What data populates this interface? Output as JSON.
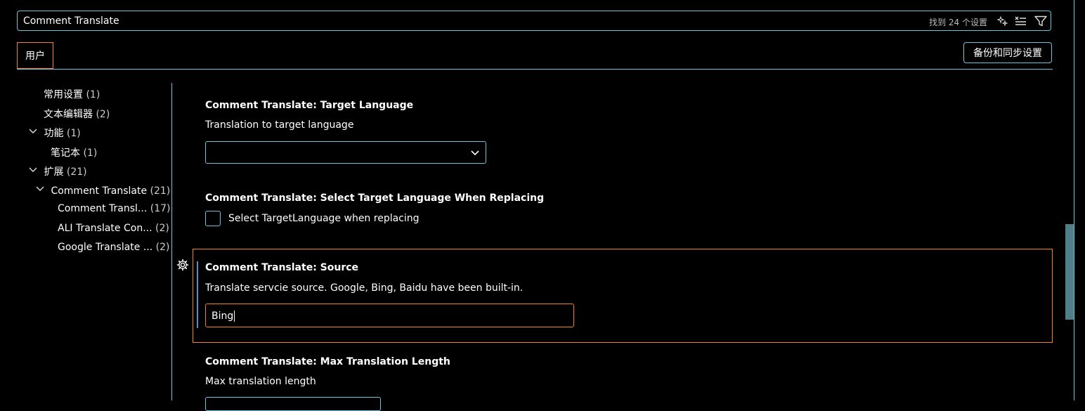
{
  "search": {
    "value": "Comment Translate",
    "result_count": "找到 24 个设置",
    "icons": [
      "sparkle-filter-icon",
      "clear-filter-icon",
      "filter-icon"
    ]
  },
  "scope": {
    "user_tab": "用户",
    "sync_button": "备份和同步设置"
  },
  "toc": {
    "items": [
      {
        "label": "常用设置",
        "count": "(1)"
      },
      {
        "label": "文本编辑器",
        "count": "(2)"
      },
      {
        "label": "功能",
        "count": "(1)"
      },
      {
        "label": "笔记本",
        "count": "(1)"
      },
      {
        "label": "扩展",
        "count": "(21)"
      },
      {
        "label": "Comment Translate",
        "count": "(21)"
      },
      {
        "label": "Comment Transl...",
        "count": "(17)"
      },
      {
        "label": "ALI Translate Con...",
        "count": "(2)"
      },
      {
        "label": "Google Translate ...",
        "count": "(2)"
      }
    ]
  },
  "settings": {
    "target_language": {
      "title": "Comment Translate: Target Language",
      "description": "Translation to target language",
      "value": ""
    },
    "select_target": {
      "title": "Comment Translate: Select Target Language When Replacing",
      "checkbox_label": "Select TargetLanguage when replacing",
      "checked": false
    },
    "source": {
      "title": "Comment Translate: Source",
      "description": "Translate servcie source. Google, Bing, Baidu have been built-in.",
      "value": "Bing"
    },
    "max_length": {
      "title": "Comment Translate: Max Translation Length",
      "description": "Max translation length"
    }
  },
  "colors": {
    "background": "#000000",
    "border_accent": "#6fc3df",
    "focus": "#f38518"
  }
}
